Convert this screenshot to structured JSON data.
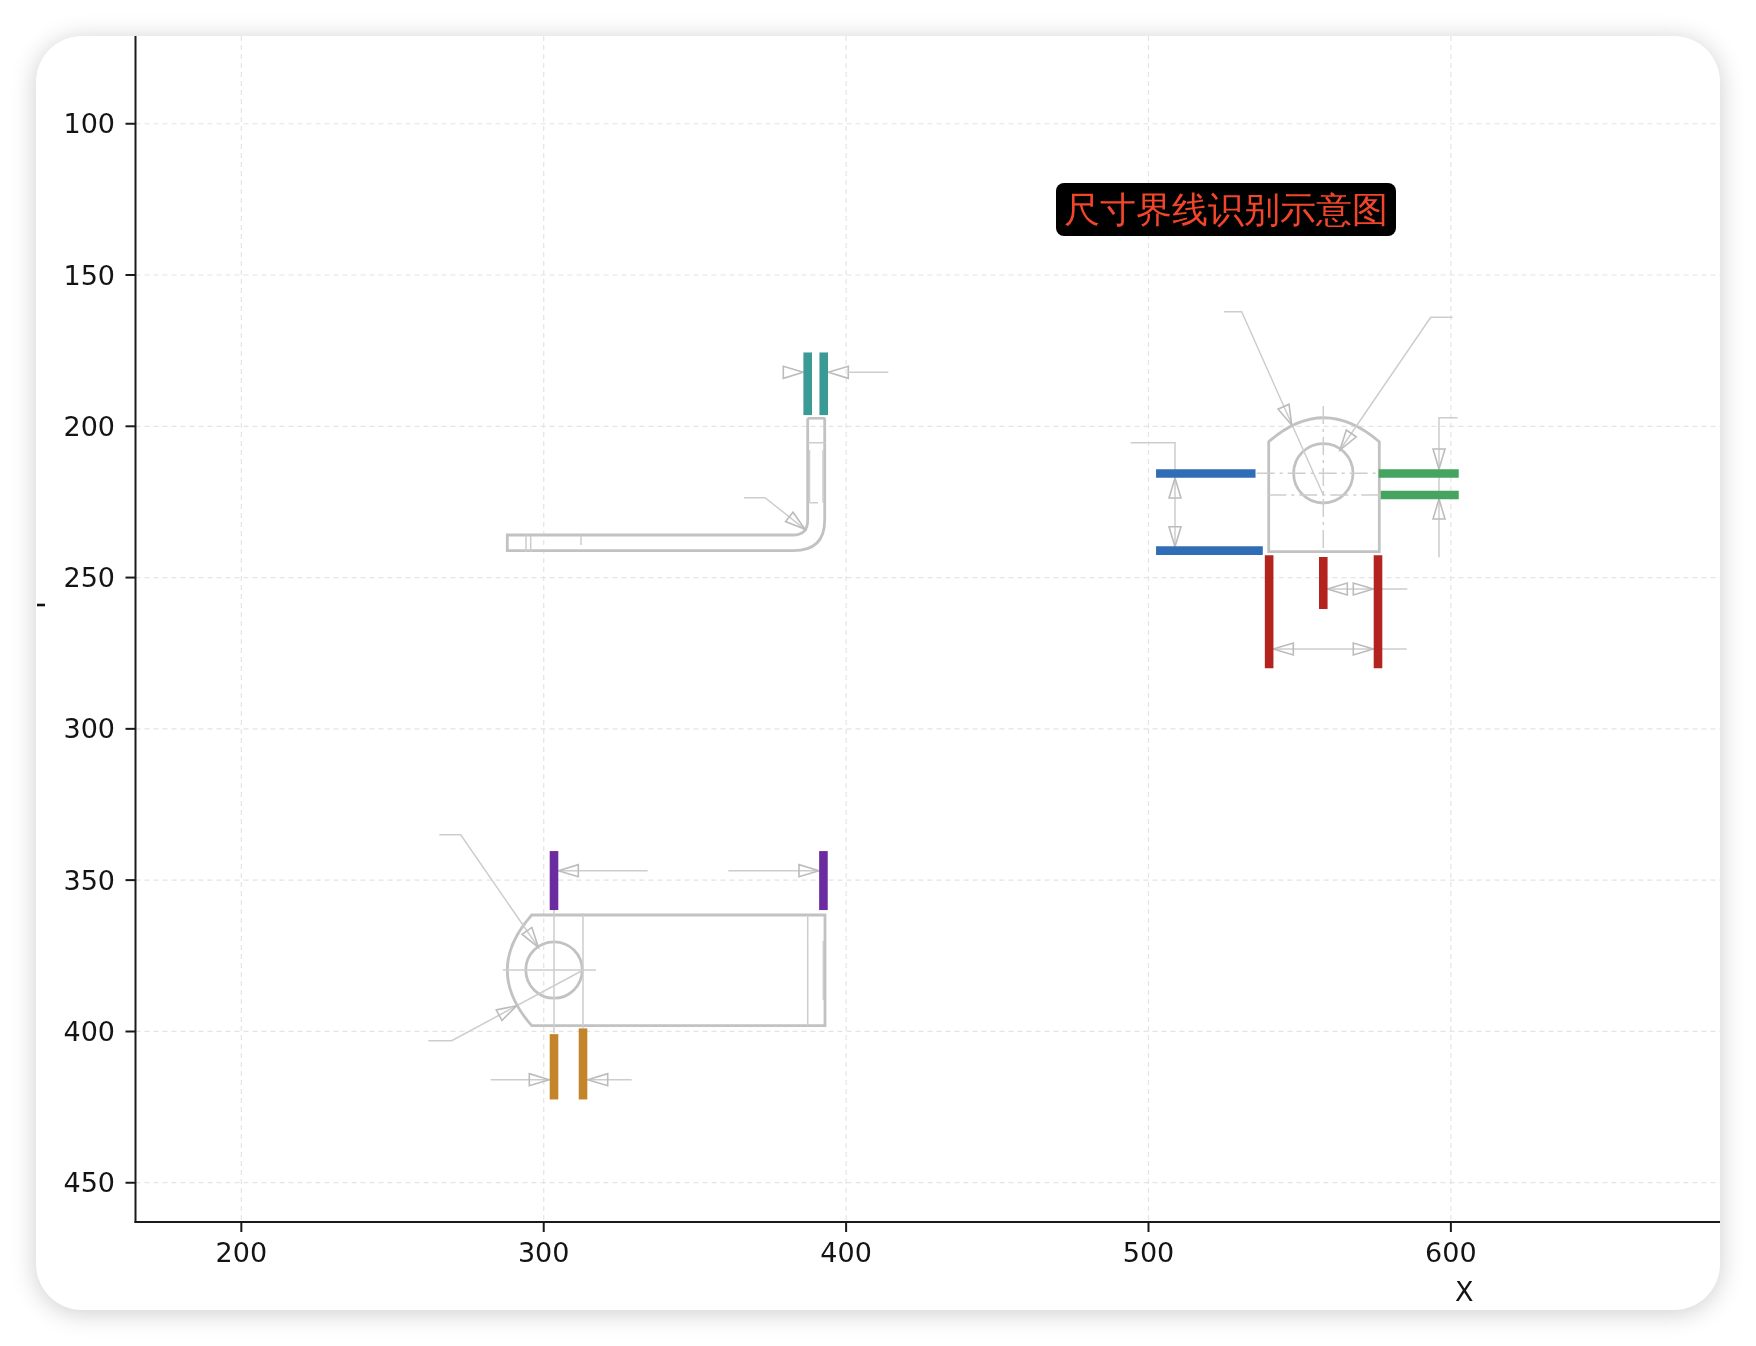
{
  "figure": {
    "chart_data": {
      "type": "line",
      "xlabel": "X",
      "xlim": [
        165,
        689
      ],
      "ylim": [
        463,
        71
      ],
      "xticks": [
        200,
        300,
        400,
        500,
        600
      ],
      "yticks": [
        100,
        150,
        200,
        250,
        300,
        350,
        400,
        450
      ],
      "grid": true,
      "series": [
        {
          "color": "#3a9a95",
          "x": [
            387.3,
            387.3,
            null,
            392.6,
            392.6
          ],
          "values": [
            175.6,
            196.3,
            null,
            175.6,
            196.3
          ]
        },
        {
          "color": "#2f6db6",
          "x": [
            502.5,
            535.4,
            null,
            502.5,
            537.8
          ],
          "values": [
            215.6,
            215.6,
            null,
            241.1,
            241.1
          ]
        },
        {
          "color": "#46a461",
          "x": [
            576.1,
            602.6,
            null,
            576.8,
            602.6
          ],
          "values": [
            215.6,
            215.6,
            null,
            222.7,
            222.7
          ]
        },
        {
          "color": "#b3241e",
          "x": [
            539.9,
            539.9,
            null,
            557.8,
            557.8,
            null,
            575.9,
            575.9
          ],
          "values": [
            242.6,
            280,
            null,
            243.2,
            260.4,
            null,
            242.6,
            280
          ]
        },
        {
          "color": "#6a2c9f",
          "x": [
            303.4,
            303.4,
            null,
            392.5,
            392.5
          ],
          "values": [
            340.4,
            359.9,
            null,
            340.4,
            359.9
          ]
        },
        {
          "color": "#c4852a",
          "x": [
            303.4,
            303.4,
            null,
            313,
            313
          ],
          "values": [
            400.9,
            422.5,
            null,
            399,
            422.5
          ]
        }
      ],
      "annotations": [
        "尺寸界线识别示意图"
      ]
    }
  }
}
